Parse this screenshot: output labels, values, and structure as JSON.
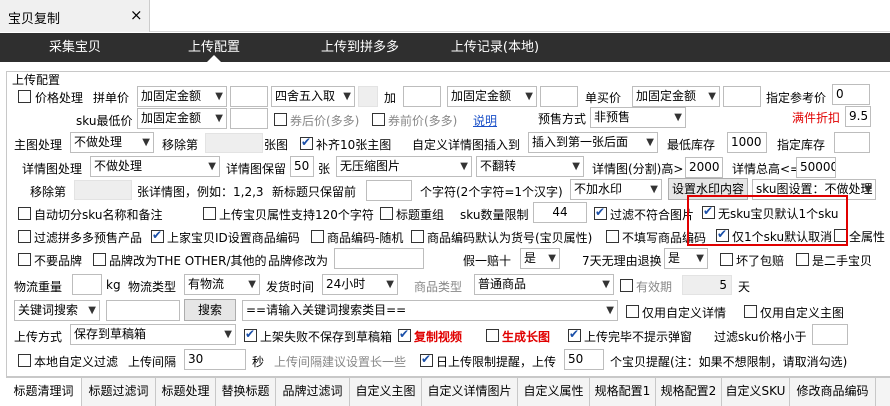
{
  "window": {
    "tab_title": "宝贝复制",
    "close": "×"
  },
  "nav": [
    "采集宝贝",
    "上传配置",
    "上传到拼多多",
    "上传记录(本地)"
  ],
  "section_title": "上传配置",
  "r1": {
    "price_proc": "价格处理",
    "group_price": "拼单价",
    "sel1": "加固定金额",
    "round": "四舍五入取",
    "add": "加",
    "sel2": "加固定金额",
    "single_price": "单买价",
    "sel3": "加固定金额",
    "ref_price": "指定参考价",
    "ref_val": "0"
  },
  "r2": {
    "sku_min": "sku最低价",
    "sel1": "加固定金额",
    "coupon_after": "券后价(多多)",
    "coupon_before": "券前价(多多)",
    "explain": "说明",
    "presale_label": "预售方式",
    "presale": "非预售",
    "full_discount": "满件折扣",
    "discount_val": "9.5"
  },
  "r3": {
    "main_proc": "主图处理",
    "main_sel": "不做处理",
    "remove_label": "移除第",
    "unit": "张图",
    "fill10": "补齐10张主图",
    "custom_detail": "自定义详情图插入到",
    "insert_sel": "插入到第一张后面",
    "min_stock": "最低库存",
    "min_stock_val": "1000",
    "set_stock": "指定库存"
  },
  "r4": {
    "detail_proc": "详情图处理",
    "detail_sel": "不做处理",
    "detail_count_label": "详情图保留",
    "count": "50",
    "unit": "张",
    "compress_sel": "无压缩图片",
    "flip_sel": "不翻转",
    "split_label": "详情图(分割)高>",
    "split_val": "2000",
    "total_label": "详情总高<=",
    "total_val": "50000"
  },
  "r5": {
    "remove_label": "移除第",
    "detail_example": "张详情图，例如：1,2,3",
    "new_title": "新标题只保留前",
    "chars": "个字符(2个字符=1个汉字)",
    "watermark": "不加水印",
    "watermark_set": "设置水印内容",
    "sku_set": "sku图设置：不做处理"
  },
  "r6": {
    "auto_split": "自动切分sku名称和备注",
    "attr120": "上传宝贝属性支持120个字符",
    "title_regroup": "标题重组",
    "sku_limit_label": "sku数量限制",
    "sku_limit": "44",
    "filter_img": "过滤不符合图片",
    "no_sku_default": "无sku宝贝默认1个sku"
  },
  "r7": {
    "filter_presale": "过滤拼多多预售产品",
    "shop_id_code": "上家宝贝ID设置商品编码",
    "code_random": "商品编码-随机",
    "code_default": "商品编码默认为货号(宝贝属性)",
    "no_code": "不填写商品编码",
    "one_sku_cancel": "仅1个sku默认取消",
    "all_attr": "全属性"
  },
  "r8": {
    "no_brand": "不要品牌",
    "brand_other": "品牌改为THE OTHER/其他的",
    "brand_change": "品牌修改为",
    "fake_label": "假一赔十",
    "fake": "是",
    "return_label": "7天无理由退换",
    "return": "是",
    "broken": "坏了包赔",
    "second_hand": "是二手宝贝"
  },
  "r9": {
    "weight": "物流重量",
    "kg": "kg",
    "logi_type": "物流类型",
    "logi_sel": "有物流",
    "ship_time": "发货时间",
    "ship_sel": "24小时",
    "goods_type_label": "商品类型",
    "goods_type": "普通商品",
    "valid_label": "有效期",
    "valid_val": "5",
    "days": "天"
  },
  "r10": {
    "keyword_sel": "关键词搜索",
    "search_btn": "搜索",
    "cat_sel": "==请输入关键词搜索类目==",
    "only_custom_detail": "仅用自定义详情",
    "only_custom_main": "仅用自定义主图"
  },
  "r11": {
    "upload_mode": "上传方式",
    "mode_sel": "保存到草稿箱",
    "fail_draft": "上架失败不保存到草稿箱",
    "copy_video": "复制视频",
    "gen_long": "生成长图",
    "no_popup": "上传完毕不提示弹窗",
    "filter_sku_price": "过滤sku价格小于"
  },
  "r12": {
    "local_filter": "本地自定义过滤",
    "interval_label": "上传间隔",
    "interval": "30",
    "sec": "秒",
    "interval_hint": "上传间隔建议设置长一些",
    "daily_limit": "日上传限制提醒，上传",
    "daily_val": "50",
    "daily_note": "个宝贝提醒(注：如果不想限制，请取消勾选)"
  },
  "bottom_tabs": [
    "标题清理词",
    "标题过滤词",
    "标题处理",
    "替换标题",
    "品牌过滤词",
    "自定义主图",
    "自定义详情图片",
    "自定义属性",
    "规格配置1",
    "规格配置2",
    "自定义SKU",
    "修改商品编码"
  ]
}
